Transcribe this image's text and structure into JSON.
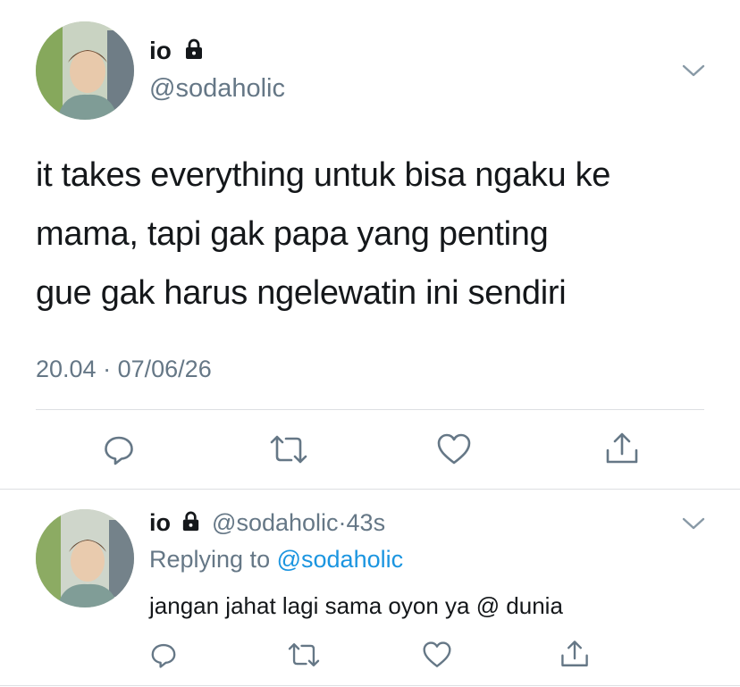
{
  "main_tweet": {
    "name": "io",
    "handle": "@sodaholic",
    "lines": [
      "it takes everything untuk bisa ngaku ke",
      "mama, tapi gak papa yang penting",
      "gue gak harus ngelewatin ini sendiri"
    ],
    "time": "20.04",
    "separator": "·",
    "date": "07/06/26",
    "icons": {
      "lock": "lock-icon",
      "menu": "chevron-down-icon",
      "reply": "reply-icon",
      "retweet": "retweet-icon",
      "like": "heart-icon",
      "share": "share-icon"
    }
  },
  "reply_tweet": {
    "name": "io",
    "handle": "@sodaholic",
    "separator": "·",
    "age": "43s",
    "replying_prefix": "Replying to",
    "replying_handle": "@sodaholic",
    "text": "jangan jahat lagi sama oyon ya @ dunia"
  },
  "colors": {
    "text": "#14171a",
    "secondary": "#657786",
    "link": "#1b95e0",
    "divider": "#dcdfe2"
  }
}
